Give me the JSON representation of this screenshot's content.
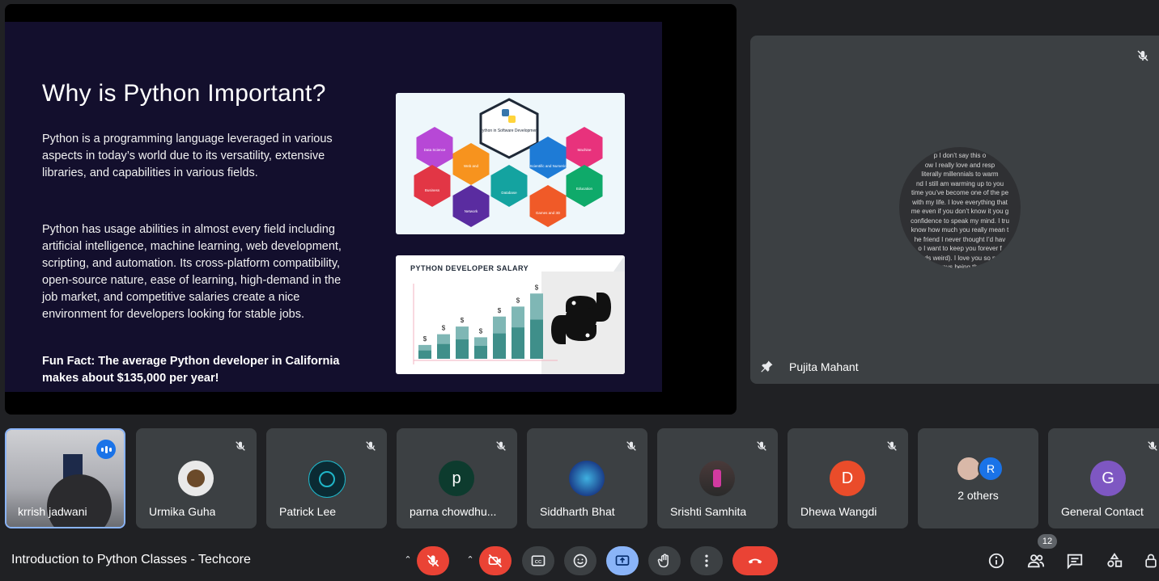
{
  "slide": {
    "title": "Why is Python Important?",
    "paragraph1": "Python is a programming language leveraged in various aspects in today’s world due to its versatility, extensive libraries, and capabilities in various fields.",
    "paragraph2": "Python has usage abilities in almost every field including artificial intelligence, machine learning, web development, scripting, and automation. Its cross-platform compatibility, open-source nature, ease of learning, high-demand in the job market, and competitive salaries create a nice environment for developers looking for stable jobs.",
    "fun_fact": "Fun Fact: The average Python developer in California makes about $135,000 per year!",
    "diagram": {
      "center": "Python in Software Development",
      "items": [
        "Data Science",
        "Web and Internet Development",
        "Scientific and Numeric",
        "Machine Learning",
        "Business Applications",
        "Network Programming",
        "Database Access",
        "Games and 3D Graphics",
        "Education"
      ]
    },
    "salary_title": "PYTHON DEVELOPER SALARY",
    "salary_symbol": "$",
    "salary_bars": [
      0.18,
      0.32,
      0.42,
      0.28,
      0.55,
      0.68,
      0.85
    ]
  },
  "pinned": {
    "name": "Pujita Mahant",
    "handwriting": [
      "p I don’t say this o",
      "ow I really love and resp",
      "literally millennials to warm",
      "nd I still am warming up to you",
      "time you’ve become one of the pe",
      "with my life. I love everything that",
      "me even if you don’t know it you g",
      "confidence to speak my mind. I tru",
      "know how much you really mean t",
      "he friend I never thought I’d hav",
      "o I want to keep you forever f",
      "rds weird). I love you so m",
      "lways being ther"
    ]
  },
  "participants": [
    {
      "name": "krrish jadwani"
    },
    {
      "name": "Urmika Guha"
    },
    {
      "name": "Patrick Lee"
    },
    {
      "name": "parna chowdhu...",
      "initial": "p",
      "color": "#0d3b2e"
    },
    {
      "name": "Siddharth Bhat"
    },
    {
      "name": "Srishti Samhita"
    },
    {
      "name": "Dhewa Wangdi",
      "initial": "D",
      "color": "#ea4c2a"
    },
    {
      "name": "2 others",
      "initial": "R",
      "color": "#1a73e8"
    },
    {
      "name": "General Contact",
      "initial": "G",
      "color": "#7e57c2"
    }
  ],
  "meeting": {
    "title": "Introduction to Python Classes - Techcore",
    "participant_count": "12"
  },
  "colors": {
    "end_call": "#ea4335",
    "present": "#8ab4f8",
    "speaking": "#8ab4f8"
  }
}
